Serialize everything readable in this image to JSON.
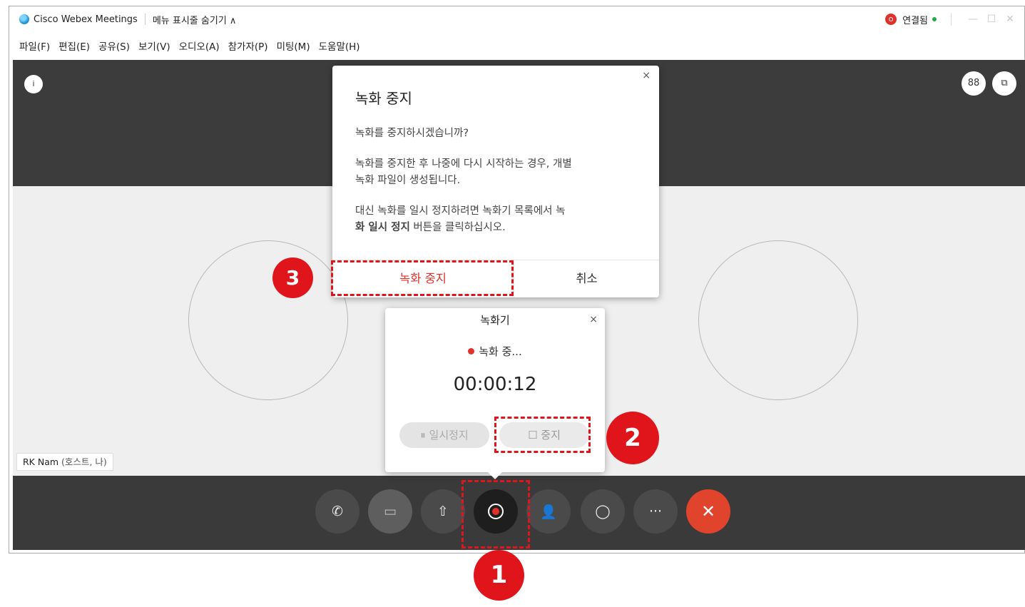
{
  "titlebar": {
    "app_title": "Cisco Webex Meetings",
    "menu_toggle": "메뉴 표시줄 숨기기 ∧",
    "connection_status": "연결됨",
    "minimize_glyph": "—",
    "maximize_glyph": "☐",
    "close_glyph": "✕"
  },
  "menubar": {
    "items": [
      "파일(F)",
      "편집(E)",
      "공유(S)",
      "보기(V)",
      "오디오(A)",
      "참가자(P)",
      "미팅(M)",
      "도움말(H)"
    ]
  },
  "stage": {
    "info_glyph": "i",
    "grid_glyph": "88",
    "popout_glyph": "⧉",
    "participant_name": "RK Nam",
    "participant_role": "(호스트, 나)"
  },
  "dialog": {
    "close_glyph": "×",
    "title": "녹화 중지",
    "question": "녹화를 중지하시겠습니까?",
    "info_line1": "녹화를 중지한 후 나중에 다시 시작하는 경우, 개별",
    "info_line2": "녹화 파일이 생성됩니다.",
    "pause_line1": "대신 녹화를 일시 정지하려면 녹화기 목록에서 녹",
    "pause_bold": "화 일시 정지",
    "pause_line2_rest": " 버튼을 클릭하십시오.",
    "stop_label": "녹화 중지",
    "cancel_label": "취소"
  },
  "recorder": {
    "title": "녹화기",
    "close_glyph": "×",
    "status": "녹화 중...",
    "timer": "00:00:12",
    "pause_label": "⏸ 일시정지",
    "stop_label": "☐ 중지"
  },
  "controls": {
    "audio_icon": "✆",
    "video_icon": "▭",
    "share_icon": "⇧",
    "participants_icon": "👤",
    "chat_icon": "◯",
    "more_icon": "···",
    "end_icon": "✕"
  },
  "annotations": {
    "marker_1": "1",
    "marker_2": "2",
    "marker_3": "3"
  },
  "colors": {
    "accent_red": "#e0312b",
    "annotation_red": "#e0141b",
    "end_call": "#e0442c",
    "stage_dark": "#3c3c3c"
  }
}
